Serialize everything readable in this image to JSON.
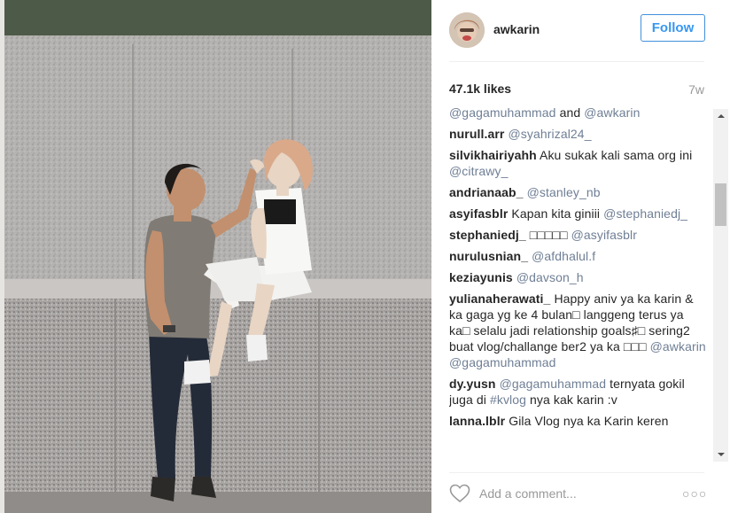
{
  "post": {
    "username": "awkarin",
    "follow_label": "Follow",
    "likes": "47.1k likes",
    "time": "7w"
  },
  "comments": {
    "caption_tail": [
      {
        "text": "@gagamuhammad",
        "type": "mention"
      },
      {
        "text": " and ",
        "type": "text"
      },
      {
        "text": "@awkarin",
        "type": "mention"
      }
    ],
    "items": [
      {
        "author": "nurull.arr",
        "parts": [
          {
            "text": "@syahrizal24_",
            "type": "mention"
          }
        ]
      },
      {
        "author": "silvikhairiyahh",
        "parts": [
          {
            "text": "Aku sukak kali sama org ini ",
            "type": "text"
          },
          {
            "text": "@citrawy_",
            "type": "mention"
          }
        ]
      },
      {
        "author": "andrianaab_",
        "parts": [
          {
            "text": "@stanley_nb",
            "type": "mention"
          }
        ]
      },
      {
        "author": "asyifasblr",
        "parts": [
          {
            "text": "Kapan kita giniii ",
            "type": "text"
          },
          {
            "text": "@stephaniedj_",
            "type": "mention"
          }
        ]
      },
      {
        "author": "stephaniedj_",
        "parts": [
          {
            "text": "□□□□□ ",
            "type": "text"
          },
          {
            "text": "@asyifasblr",
            "type": "mention"
          }
        ]
      },
      {
        "author": "nurulusnian_",
        "parts": [
          {
            "text": "@afdhalul.f",
            "type": "mention"
          }
        ]
      },
      {
        "author": "keziayunis",
        "parts": [
          {
            "text": "@davson_h",
            "type": "mention"
          }
        ]
      },
      {
        "author": "yulianaherawati_",
        "parts": [
          {
            "text": "Happy aniv ya ka karin & ka gaga yg ke 4 bulan□ langgeng terus ya ka□ selalu jadi relationship goals♯□ sering2 buat vlog/challange ber2 ya ka □□□ ",
            "type": "text"
          },
          {
            "text": "@awkarin",
            "type": "mention"
          },
          {
            "text": " ",
            "type": "text"
          },
          {
            "text": "@gagamuhammad",
            "type": "mention"
          }
        ]
      },
      {
        "author": "dy.yusn",
        "parts": [
          {
            "text": "@gagamuhammad",
            "type": "mention"
          },
          {
            "text": " ternyata gokil juga di ",
            "type": "text"
          },
          {
            "text": "#kvlog",
            "type": "mention"
          },
          {
            "text": " nya kak karin :v",
            "type": "text"
          }
        ]
      },
      {
        "author": "lanna.lblr",
        "parts": [
          {
            "text": "Gila Vlog nya ka Karin keren",
            "type": "text"
          }
        ]
      }
    ]
  },
  "footer": {
    "comment_placeholder": "Add a comment...",
    "more_label": "○○○"
  },
  "icons": {
    "heart": "heart-icon",
    "more": "more-options-icon"
  },
  "colors": {
    "accent": "#3897f0",
    "mention": "#6f7f95",
    "muted": "#999999"
  }
}
